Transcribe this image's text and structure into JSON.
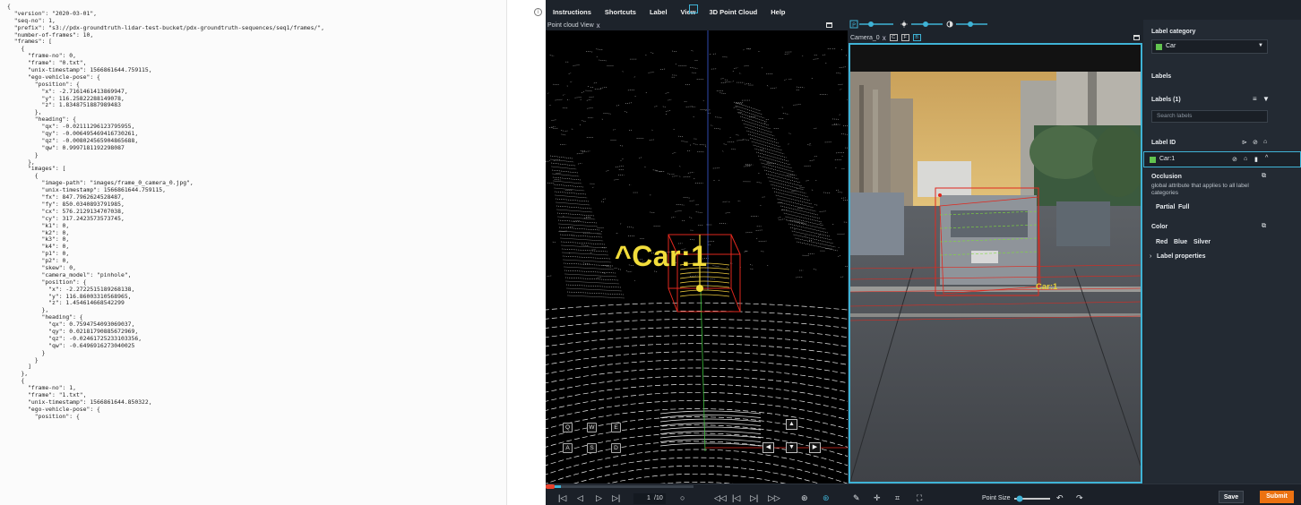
{
  "json_lines": [
    "{",
    "  \"version\": \"2020-03-01\",",
    "  \"seq-no\": 1,",
    "  \"prefix\": \"s3://pdx-groundtruth-lidar-test-bucket/pdx-groundtruth-sequences/seq1/frames/\",",
    "  \"number-of-frames\": 10,",
    "  \"frames\": [",
    "    {",
    "      \"frame-no\": 0,",
    "      \"frame\": \"0.txt\",",
    "      \"unix-timestamp\": 1566861644.759115,",
    "      \"ego-vehicle-pose\": {",
    "        \"position\": {",
    "          \"x\": -2.7161461413869947,",
    "          \"y\": 116.25822288149078,",
    "          \"z\": 1.8348751887989483",
    "        },",
    "        \"heading\": {",
    "          \"qx\": -0.02111296123795955,",
    "          \"qy\": -0.006495469416730261,",
    "          \"qz\": -0.008024565904865688,",
    "          \"qw\": 0.9997181192298087",
    "        }",
    "      },",
    "      \"images\": [",
    "        {",
    "          \"image-path\": \"images/frame_0_camera_0.jpg\",",
    "          \"unix-timestamp\": 1566861644.759115,",
    "          \"fx\": 847.7962624528487,",
    "          \"fy\": 850.0340893791985,",
    "          \"cx\": 576.2129134707038,",
    "          \"cy\": 317.2423573573745,",
    "          \"k1\": 0,",
    "          \"k2\": 0,",
    "          \"k3\": 0,",
    "          \"k4\": 0,",
    "          \"p1\": 0,",
    "          \"p2\": 0,",
    "          \"skew\": 0,",
    "          \"camera_model\": \"pinhole\",",
    "          \"position\": {",
    "            \"x\": -2.2722515189268138,",
    "            \"y\": 116.86003310568965,",
    "            \"z\": 1.454614668542299",
    "          },",
    "          \"heading\": {",
    "            \"qx\": 0.7594754093069037,",
    "            \"qy\": 0.02181790885672969,",
    "            \"qz\": -0.02461725233103356,",
    "            \"qw\": -0.6496916273040025",
    "          }",
    "        }",
    "      ]",
    "    },",
    "    {",
    "      \"frame-no\": 1,",
    "      \"frame\": \"1.txt\",",
    "      \"unix-timestamp\": 1566861644.850322,",
    "      \"ego-vehicle-pose\": {",
    "        \"position\": {"
  ],
  "menu": [
    "Instructions",
    "Shortcuts",
    "Label",
    "View",
    "3D Point Cloud",
    "Help"
  ],
  "point_cloud": {
    "title": "Point cloud View",
    "close": "x",
    "label_text": "^Car:1",
    "keys": [
      "Q",
      "W",
      "E",
      "A",
      "S",
      "D"
    ]
  },
  "camera": {
    "title": "Camera_0",
    "close": "x",
    "btn_c": "C",
    "btn_f": "F",
    "btn_b": "B",
    "label_text": "Car:1",
    "btn_p": "P"
  },
  "right_panel": {
    "label_category_heading": "Label category",
    "category_value": "Car",
    "labels_heading": "Labels",
    "labels_count": "Labels (1)",
    "search_placeholder": "Search labels",
    "label_id_heading": "Label ID",
    "label_item": "Car:1",
    "occlusion_heading": "Occlusion",
    "occlusion_desc": "global attribute that applies to all label categories",
    "occlusion_options": [
      "Partial",
      "Full"
    ],
    "color_heading": "Color",
    "color_options": [
      "Red",
      "Blue",
      "Silver"
    ],
    "label_properties": "Label properties"
  },
  "bottom_bar": {
    "frame_current": "1",
    "frame_total": "/10",
    "point_size_label": "Point Size",
    "save_label": "Save",
    "submit_label": "Submit",
    "progress": 0.1
  },
  "colors": {
    "accent": "#3fb3d6",
    "submit": "#ec7211",
    "label_yellow": "#f2dd3b",
    "category_swatch": "#62c34f",
    "box_red": "#e0281e"
  }
}
